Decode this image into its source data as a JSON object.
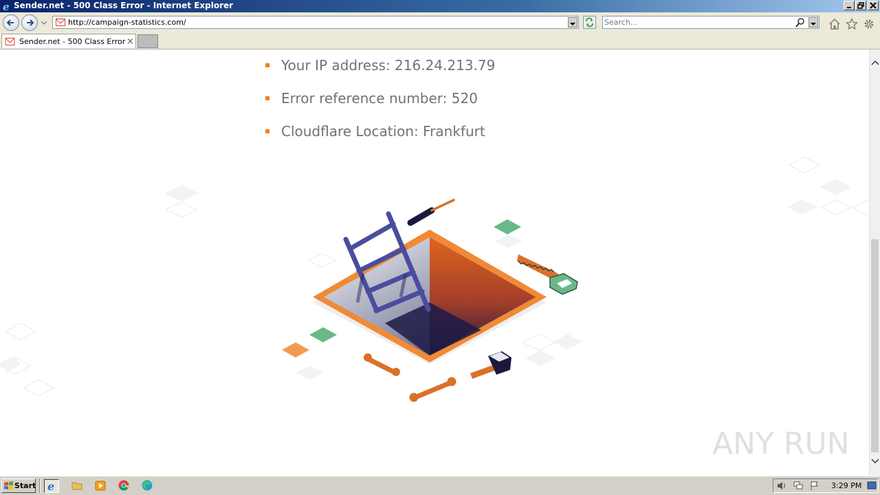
{
  "window": {
    "title": "Sender.net - 500 Class Error - Internet Explorer"
  },
  "addressbar": {
    "url": "http://campaign-statistics.com/"
  },
  "search": {
    "placeholder": "Search..."
  },
  "tabs": [
    {
      "label": "Sender.net - 500 Class Error",
      "favicon": "envelope-icon"
    }
  ],
  "page": {
    "details": [
      {
        "text": "Your IP address: 216.24.213.79"
      },
      {
        "text": "Error reference number: 520"
      },
      {
        "text": "Cloudflare Location: Frankfurt"
      }
    ],
    "illustration": "hole-with-ladder-and-tools"
  },
  "watermark": {
    "text": "ANY RUN"
  },
  "taskbar": {
    "start_label": "Start",
    "clock": "3:29 PM",
    "pinned": [
      "internet-explorer-icon",
      "folder-icon",
      "media-player-icon",
      "chrome-icon",
      "edge-icon"
    ]
  },
  "colors": {
    "accent": "#f38020",
    "text": "#6d737a",
    "titlebar": "#0a246a",
    "chrome": "#ece9d8"
  }
}
